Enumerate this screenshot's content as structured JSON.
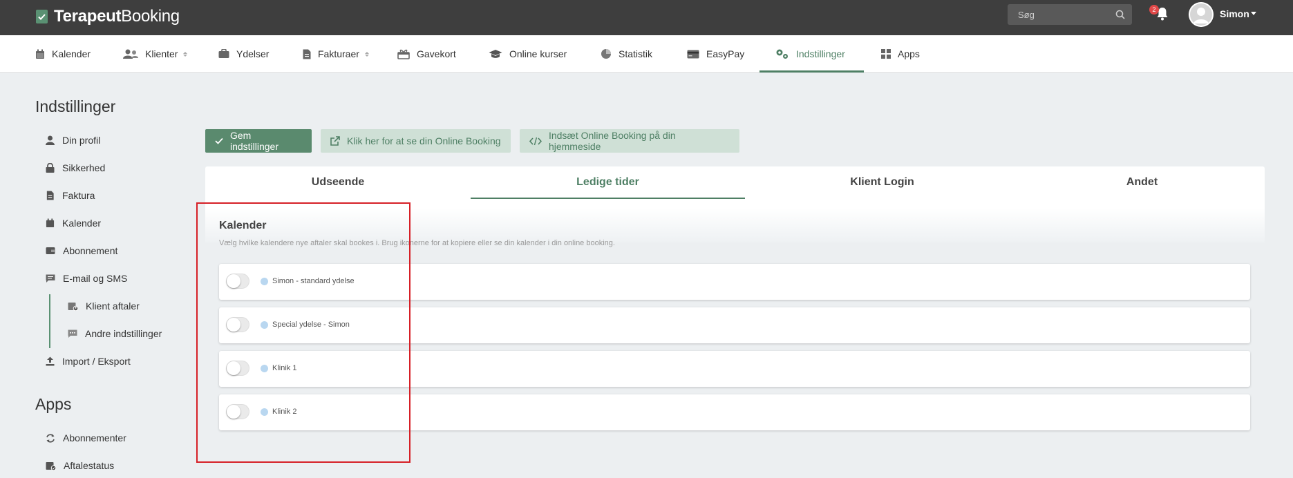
{
  "app": {
    "logo_bold": "Terapeut",
    "logo_light": "Booking",
    "search_placeholder": "Søg",
    "notification_count": "2",
    "user_name": "Simon"
  },
  "nav": {
    "items": [
      {
        "label": "Kalender",
        "icon": "calendar-icon"
      },
      {
        "label": "Klienter",
        "icon": "users-icon"
      },
      {
        "label": "Ydelser",
        "icon": "briefcase-icon"
      },
      {
        "label": "Fakturaer",
        "icon": "invoice-icon"
      },
      {
        "label": "Gavekort",
        "icon": "gift-icon"
      },
      {
        "label": "Online kurser",
        "icon": "graduation-cap-icon"
      },
      {
        "label": "Statistik",
        "icon": "pie-chart-icon"
      },
      {
        "label": "EasyPay",
        "icon": "credit-card-icon"
      },
      {
        "label": "Indstillinger",
        "icon": "gears-icon"
      },
      {
        "label": "Apps",
        "icon": "apps-grid-icon"
      }
    ],
    "active": "Indstillinger"
  },
  "sidebar": {
    "settings_heading": "Indstillinger",
    "settings_items": [
      {
        "label": "Din profil",
        "icon": "user-icon"
      },
      {
        "label": "Sikkerhed",
        "icon": "lock-icon"
      },
      {
        "label": "Faktura",
        "icon": "document-icon"
      },
      {
        "label": "Kalender",
        "icon": "calendar-icon"
      },
      {
        "label": "Abonnement",
        "icon": "wallet-icon"
      },
      {
        "label": "E-mail og SMS",
        "icon": "message-icon"
      }
    ],
    "sub_items": [
      {
        "label": "Klient aftaler",
        "icon": "calendar-user-icon"
      },
      {
        "label": "Andre indstillinger",
        "icon": "chat-dots-icon"
      }
    ],
    "import_export": {
      "label": "Import / Eksport",
      "icon": "upload-icon"
    },
    "apps_heading": "Apps",
    "apps_items": [
      {
        "label": "Abonnementer",
        "icon": "repeat-icon"
      },
      {
        "label": "Aftalestatus",
        "icon": "calendar-check-icon"
      }
    ]
  },
  "actions": {
    "save": "Gem indstillinger",
    "view_online_booking": "Klik her for at se din Online Booking",
    "embed_online_booking": "Indsæt Online Booking på din hjemmeside"
  },
  "tabs": {
    "items": [
      "Udseende",
      "Ledige tider",
      "Klient Login",
      "Andet"
    ],
    "active": "Ledige tider"
  },
  "calendar_section": {
    "title": "Kalender",
    "description": "Vælg hvilke kalendere nye aftaler skal bookes i. Brug ikonerne for at kopiere eller se din kalender i din online booking.",
    "calendars": [
      {
        "name": "Simon - standard ydelse",
        "enabled": false,
        "color": "#b9d7f0"
      },
      {
        "name": "Special ydelse - Simon",
        "enabled": false,
        "color": "#b9d7f0"
      },
      {
        "name": "Klinik 1",
        "enabled": false,
        "color": "#b9d7f0"
      },
      {
        "name": "Klinik 2",
        "enabled": false,
        "color": "#b9d7f0"
      }
    ]
  },
  "colors": {
    "accent": "#4e7f64",
    "topbar": "#3e3e3e",
    "highlight_box": "#d61f26"
  }
}
